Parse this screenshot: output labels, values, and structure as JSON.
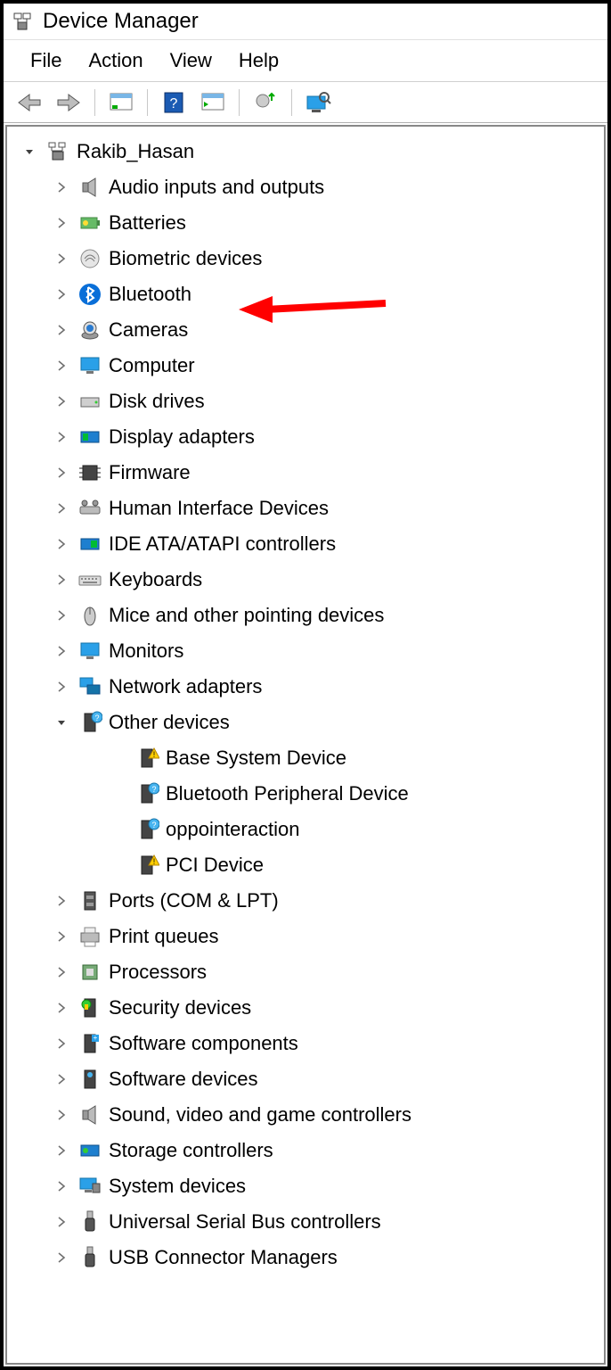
{
  "window": {
    "title": "Device Manager"
  },
  "menu": {
    "file": "File",
    "action": "Action",
    "view": "View",
    "help": "Help"
  },
  "tree": {
    "root": "Rakib_Hasan",
    "categories": [
      {
        "label": "Audio inputs and outputs",
        "icon": "speaker"
      },
      {
        "label": "Batteries",
        "icon": "battery"
      },
      {
        "label": "Biometric devices",
        "icon": "fingerprint"
      },
      {
        "label": "Bluetooth",
        "icon": "bluetooth",
        "highlight": true
      },
      {
        "label": "Cameras",
        "icon": "camera"
      },
      {
        "label": "Computer",
        "icon": "monitor"
      },
      {
        "label": "Disk drives",
        "icon": "disk"
      },
      {
        "label": "Display adapters",
        "icon": "display-card"
      },
      {
        "label": "Firmware",
        "icon": "chip"
      },
      {
        "label": "Human Interface Devices",
        "icon": "hid"
      },
      {
        "label": "IDE ATA/ATAPI controllers",
        "icon": "ide"
      },
      {
        "label": "Keyboards",
        "icon": "keyboard"
      },
      {
        "label": "Mice and other pointing devices",
        "icon": "mouse"
      },
      {
        "label": "Monitors",
        "icon": "monitor"
      },
      {
        "label": "Network adapters",
        "icon": "network"
      },
      {
        "label": "Other devices",
        "icon": "unknown",
        "expanded": true,
        "children": [
          {
            "label": "Base System Device",
            "warn": true
          },
          {
            "label": "Bluetooth Peripheral Device",
            "warn": false
          },
          {
            "label": "oppointeraction",
            "warn": false
          },
          {
            "label": "PCI Device",
            "warn": true
          }
        ]
      },
      {
        "label": "Ports (COM & LPT)",
        "icon": "port"
      },
      {
        "label": "Print queues",
        "icon": "printer"
      },
      {
        "label": "Processors",
        "icon": "cpu"
      },
      {
        "label": "Security devices",
        "icon": "security"
      },
      {
        "label": "Software components",
        "icon": "component"
      },
      {
        "label": "Software devices",
        "icon": "software"
      },
      {
        "label": "Sound, video and game controllers",
        "icon": "speaker"
      },
      {
        "label": "Storage controllers",
        "icon": "storage"
      },
      {
        "label": "System devices",
        "icon": "system"
      },
      {
        "label": "Universal Serial Bus controllers",
        "icon": "usb"
      },
      {
        "label": "USB Connector Managers",
        "icon": "usb"
      }
    ]
  }
}
